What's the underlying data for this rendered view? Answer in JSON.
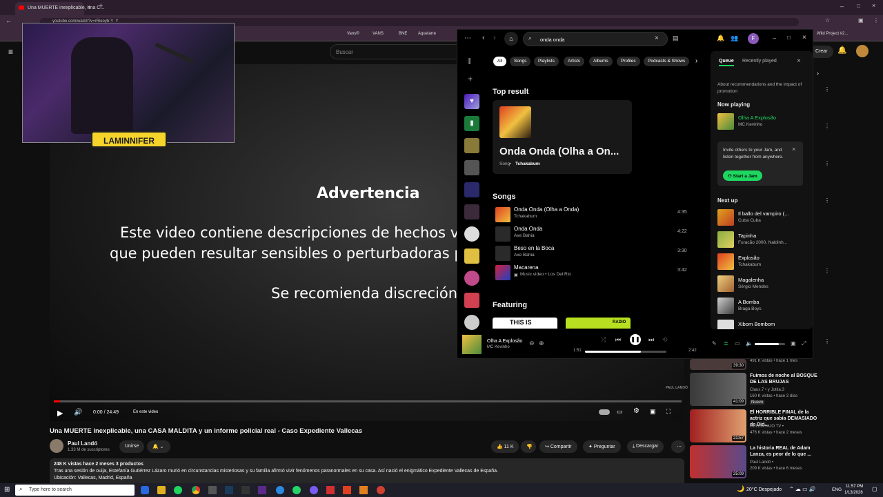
{
  "browser": {
    "tab_title": "Una MUERTE inexplicable, una C...",
    "url": "youtube.com/watch?v=rRieoyb-Y_Y",
    "bookmarks": [
      "Vans®",
      "VANS",
      "BNE",
      "Aquelarre",
      "Wild Project #2..."
    ]
  },
  "youtube": {
    "search_placeholder": "Buscar",
    "create_label": "Crear",
    "video": {
      "warning_title": "Advertencia",
      "warning_line1": "Este video contiene descripciones de hechos v",
      "warning_line2": "que pueden resultar sensibles o perturbadoras p",
      "warning_line3": "Se recomienda discreción",
      "time": "0:00 / 24:49",
      "chapter": "En este video",
      "overlay_logo": "LAMINNIFER",
      "corner_mark": "PAUL LANDÓ",
      "progress": 0.01
    },
    "title": "Una MUERTE inexplicable, una CASA MALDITA y un informe policial real - Caso Expediente Vallecas",
    "channel_name": "Paul Landó",
    "subscribers": "1.33 M de suscriptores",
    "join_label": "Unirse",
    "likes": "11 K",
    "share_label": "Compartir",
    "ask_label": "Preguntar",
    "download_label": "Descargar",
    "description": {
      "stats": "248 K vistas  hace 2 meses  3 productos",
      "text": "Tras una sesión de ouija, Estefanía Gutiérrez Lázaro murió en circunstancias misteriosas y su familia afirmó vivir fenómenos paranormales en su casa. Así nació el enigmático Expediente Vallecas de España.",
      "location": "Ubicación: Vallecas, Madrid, España"
    },
    "recommendations": [
      {
        "title": "",
        "meta1": "491 K vistas • hace 1 mes",
        "meta2": "",
        "duration": "39:30"
      },
      {
        "title": "Fuimos de noche al BOSQUE DE LAS BRUJAS",
        "meta1": "Claux.7 • y Jotita.3",
        "meta2": "160 K vistas • hace 3 días",
        "badge": "Nuevo",
        "duration": "41:09"
      },
      {
        "title": "El HORRIBLE FINAL de la actriz que sabía DEMASIADO de Did...",
        "meta1": "DELCARAJO TV •",
        "meta2": "476 K vistas • hace 2 meses",
        "duration": "21:57"
      },
      {
        "title": "La historia REAL de Adam Lanza, es peor de lo que ...",
        "meta1": "Paul Landó •",
        "meta2": "209 K vistas • hace 6 meses",
        "duration": "25:09"
      }
    ]
  },
  "spotify": {
    "search_value": "onda onda",
    "profile_initial": "F",
    "filters": [
      "All",
      "Songs",
      "Playlists",
      "Artists",
      "Albums",
      "Profiles",
      "Podcasts & Shows"
    ],
    "top_result_heading": "Top result",
    "top_result": {
      "title": "Onda Onda (Olha a On...",
      "type": "Song",
      "artist": "Tchakabum"
    },
    "songs_heading": "Songs",
    "songs": [
      {
        "name": "Onda Onda (Olha a Onda)",
        "artist": "Tchakabum",
        "duration": "4:35"
      },
      {
        "name": "Onda Onda",
        "artist": "Axe Bahia",
        "duration": "4:22"
      },
      {
        "name": "Beso en la Boca",
        "artist": "Axe Bahia",
        "duration": "3:30"
      },
      {
        "name": "Macarena",
        "artist": "Music video • Los Del Rio",
        "duration": "3:42"
      }
    ],
    "featuring_heading": "Featuring",
    "featuring_cards": [
      "THIS IS",
      "RADIO"
    ],
    "queue": {
      "tab_queue": "Queue",
      "tab_recent": "Recently played",
      "promo_note": "About recommendations and the impact of promotion",
      "now_playing_heading": "Now playing",
      "now_playing": {
        "name": "Olha A Explosão",
        "artist": "MC Kevinho"
      },
      "jam_text": "Invite others to your Jam, and listen together from anywhere.",
      "jam_button": "Start a Jam",
      "next_up_heading": "Next up",
      "next_up": [
        {
          "name": "Il ballo del vampiro (...",
          "artist": "Cuba Cuba"
        },
        {
          "name": "Tapinha",
          "artist": "Furacão 2000, Naldinh..."
        },
        {
          "name": "Explosão",
          "artist": "Tchakabum"
        },
        {
          "name": "Magalenha",
          "artist": "Sérgio Mendes"
        },
        {
          "name": "A Bomba",
          "artist": "Braga Boys"
        },
        {
          "name": "Xibom Bombom",
          "artist": ""
        }
      ]
    },
    "player": {
      "track": "Olha A Explosão",
      "artist": "MC Kevinho",
      "elapsed": "1:51",
      "total": "2:42",
      "progress": 0.69
    }
  },
  "taskbar": {
    "search_placeholder": "Type here to search",
    "weather": "20°C  Despejado",
    "lang": "ENG",
    "time": "11:57 PM",
    "date": "1/13/2026"
  }
}
